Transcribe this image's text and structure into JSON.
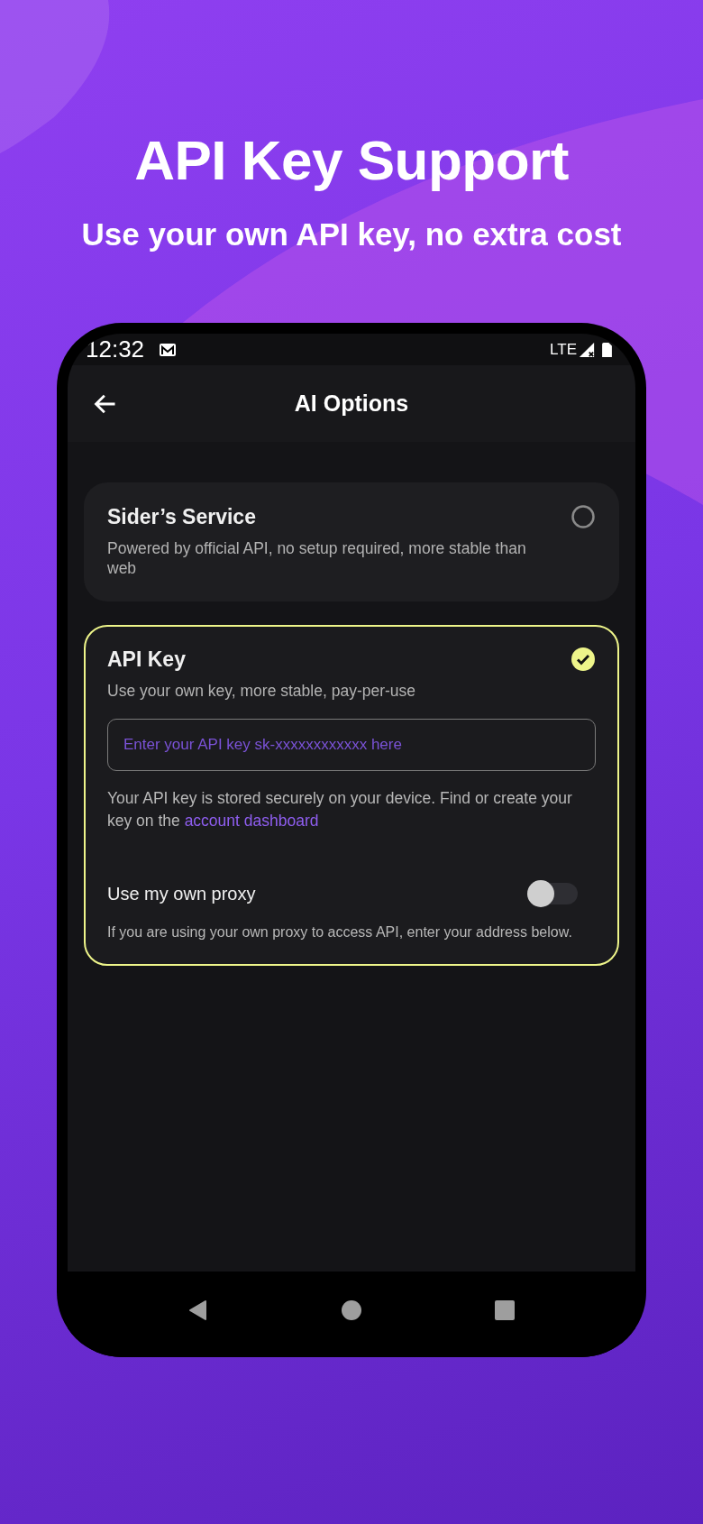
{
  "headline": "API Key Support",
  "subheadline": "Use your own API key, no extra cost",
  "status_bar": {
    "time": "12:32",
    "network": "LTE"
  },
  "app_bar": {
    "title": "AI Options"
  },
  "options": [
    {
      "title": "Sider’s Service",
      "description": "Powered by official API, no setup required, more stable than web",
      "selected": false
    },
    {
      "title": "API Key",
      "description": "Use your own key, more stable, pay-per-use",
      "selected": true,
      "input": {
        "placeholder": "Enter your API key sk-xxxxxxxxxxxx here"
      },
      "note": "Your API key is stored securely on your device. Find or create your key on the",
      "note_link": "account dashboard",
      "proxy": {
        "label": "Use my own proxy",
        "on": false,
        "hint": "If you are using your own proxy to access API, enter your address below."
      }
    }
  ]
}
